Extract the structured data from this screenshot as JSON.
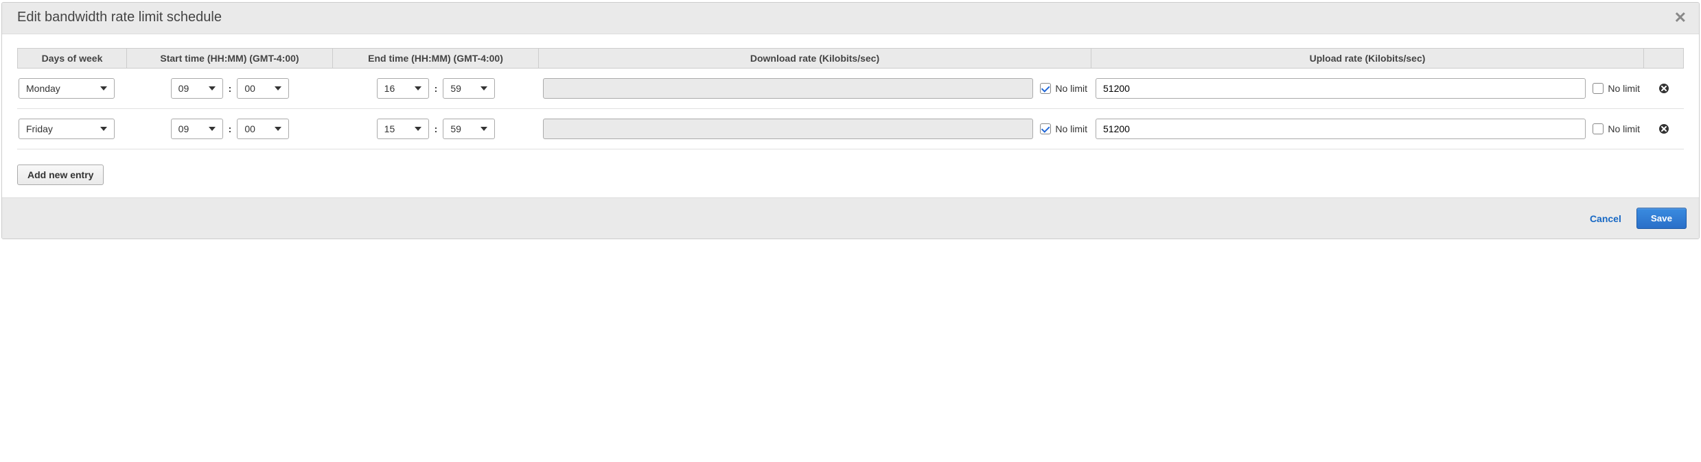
{
  "dialog": {
    "title": "Edit bandwidth rate limit schedule"
  },
  "table": {
    "headers": {
      "day": "Days of week",
      "start": "Start time (HH:MM) (GMT-4:00)",
      "end": "End time (HH:MM) (GMT-4:00)",
      "download": "Download rate (Kilobits/sec)",
      "upload": "Upload rate (Kilobits/sec)"
    },
    "no_limit_label": "No limit",
    "rows": [
      {
        "day": "Monday",
        "start_hh": "09",
        "start_mm": "00",
        "end_hh": "16",
        "end_mm": "59",
        "download_value": "",
        "download_no_limit": true,
        "upload_value": "51200",
        "upload_no_limit": false
      },
      {
        "day": "Friday",
        "start_hh": "09",
        "start_mm": "00",
        "end_hh": "15",
        "end_mm": "59",
        "download_value": "",
        "download_no_limit": true,
        "upload_value": "51200",
        "upload_no_limit": false
      }
    ]
  },
  "buttons": {
    "add_entry": "Add new entry",
    "cancel": "Cancel",
    "save": "Save"
  }
}
